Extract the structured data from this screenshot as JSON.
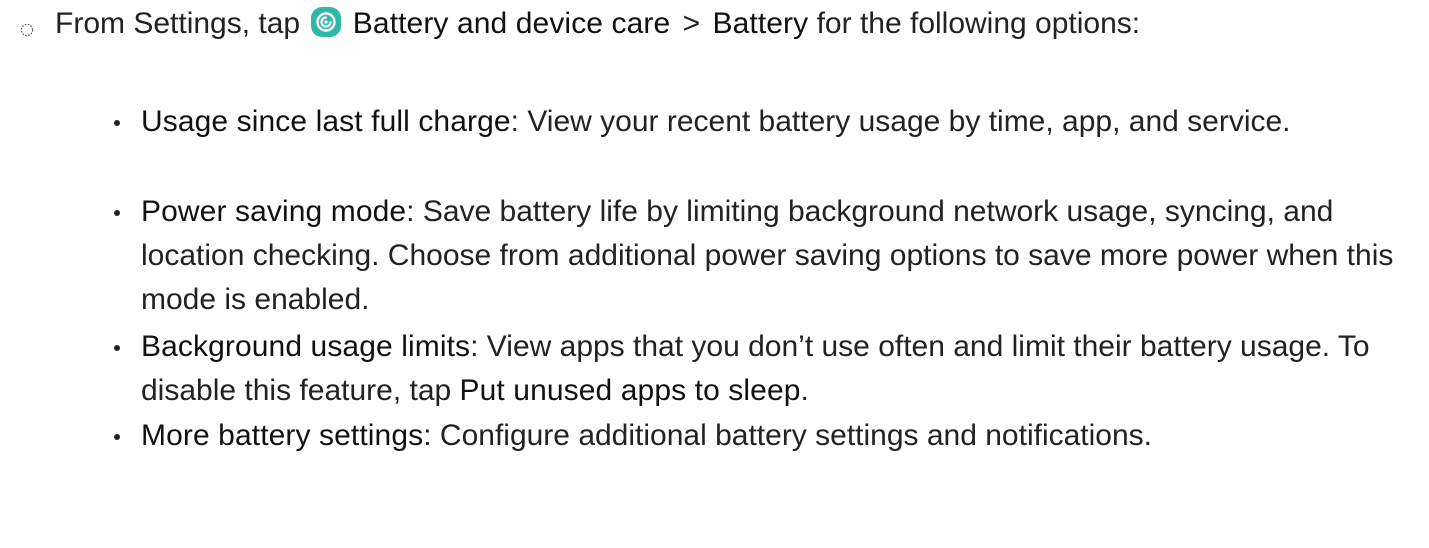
{
  "step": {
    "prefix": "From Settings, tap",
    "app_name": "Battery and device care",
    "separator": ">",
    "target": "Battery",
    "suffix": "for the following options:",
    "icon_color": "#2fb8a6"
  },
  "options": [
    {
      "title": "Usage since last full charge",
      "desc": ": View your recent battery usage by time, app, and service."
    },
    {
      "title": "Power saving mode",
      "desc": ": Save battery life by limiting background network usage, syncing, and location checking. Choose from additional power saving options to save more power when this mode is enabled."
    },
    {
      "title": "Background usage limits",
      "desc": ": View apps that you don’t use often and limit their battery usage. To disable this feature, tap ",
      "action": "Put unused apps to sleep",
      "end": "."
    },
    {
      "title": "More battery settings",
      "desc": ": Configure additional battery settings and notifications."
    }
  ]
}
